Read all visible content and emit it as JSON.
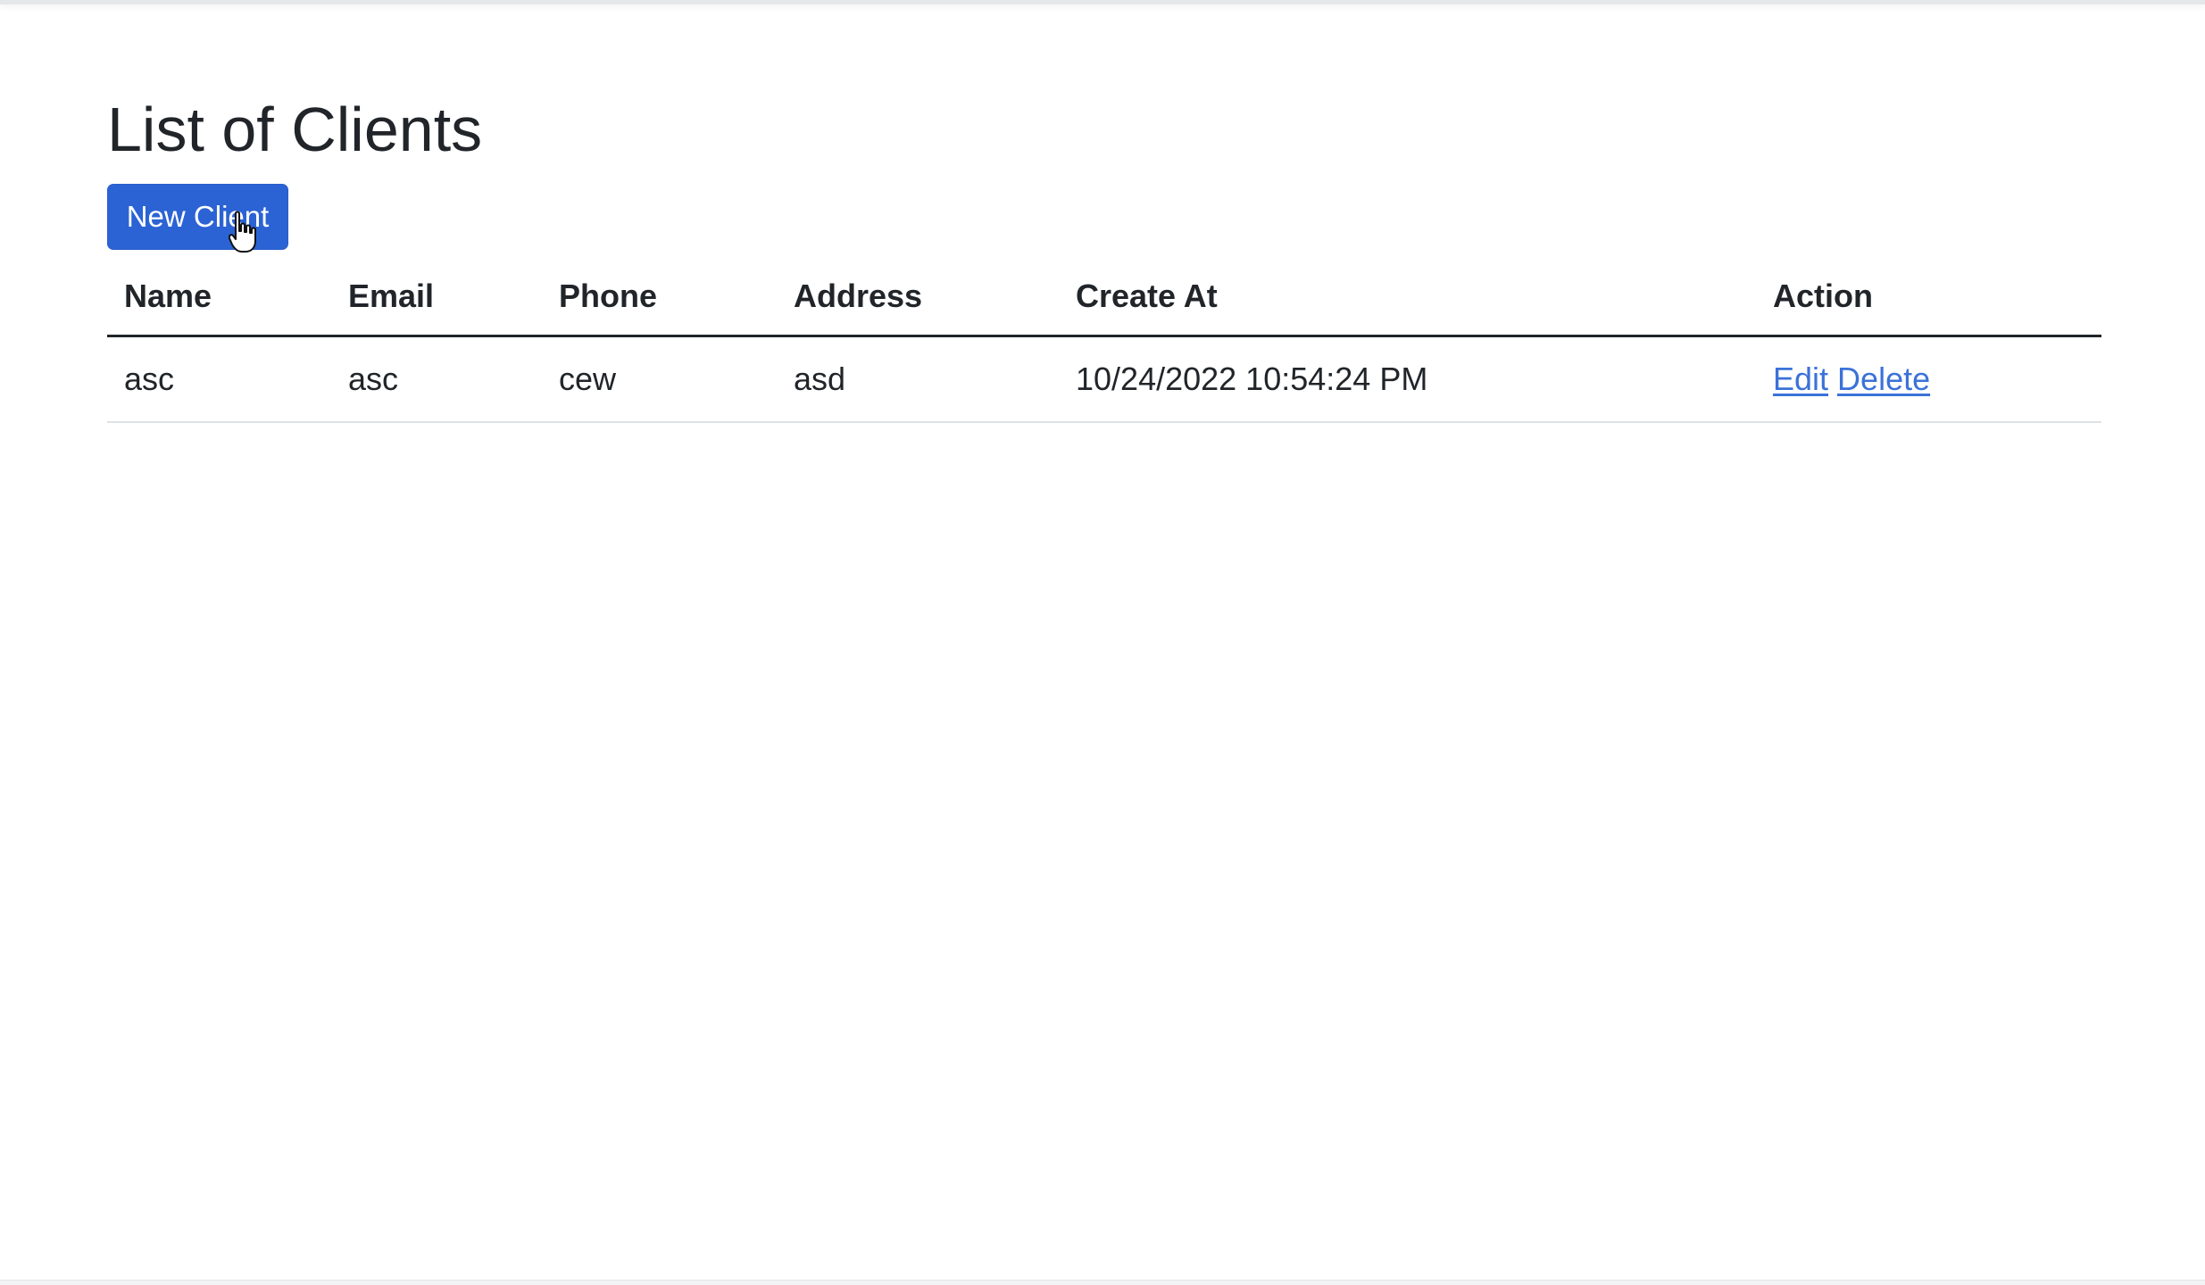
{
  "page": {
    "title": "List of Clients",
    "new_client_label": "New Client"
  },
  "table": {
    "headers": {
      "name": "Name",
      "email": "Email",
      "phone": "Phone",
      "address": "Address",
      "created_at": "Create At",
      "action": "Action"
    },
    "rows": [
      {
        "name": "asc",
        "email": "asc",
        "phone": "cew",
        "address": "asd",
        "created_at": "10/24/2022 10:54:24 PM",
        "edit_label": "Edit",
        "delete_label": "Delete"
      }
    ]
  },
  "colors": {
    "primary_button": "#2b63d4",
    "link": "#3b72d9",
    "text": "#212529"
  },
  "icons": {
    "cursor": "hand-pointer-icon"
  }
}
